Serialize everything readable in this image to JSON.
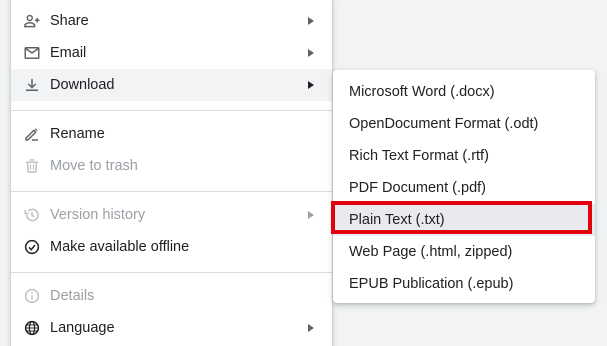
{
  "file_menu": {
    "items": [
      {
        "label": "Share",
        "icon": "person-add-icon",
        "has_submenu": true,
        "disabled": false
      },
      {
        "label": "Email",
        "icon": "mail-icon",
        "has_submenu": true,
        "disabled": false
      },
      {
        "label": "Download",
        "icon": "download-icon",
        "has_submenu": true,
        "disabled": false,
        "highlighted": true
      },
      {
        "label": "Rename",
        "icon": "rename-pencil-icon",
        "has_submenu": false,
        "disabled": false
      },
      {
        "label": "Move to trash",
        "icon": "trash-icon",
        "has_submenu": false,
        "disabled": true
      },
      {
        "label": "Version history",
        "icon": "history-icon",
        "has_submenu": true,
        "disabled": true
      },
      {
        "label": "Make available offline",
        "icon": "offline-check-icon",
        "has_submenu": false,
        "disabled": false
      },
      {
        "label": "Details",
        "icon": "info-icon",
        "has_submenu": false,
        "disabled": true
      },
      {
        "label": "Language",
        "icon": "globe-icon",
        "has_submenu": true,
        "disabled": false
      }
    ]
  },
  "download_submenu": {
    "items": [
      {
        "label": "Microsoft Word (.docx)"
      },
      {
        "label": "OpenDocument Format (.odt)"
      },
      {
        "label": "Rich Text Format (.rtf)"
      },
      {
        "label": "PDF Document (.pdf)"
      },
      {
        "label": "Plain Text (.txt)",
        "hovered": true,
        "annotated": true
      },
      {
        "label": "Web Page (.html, zipped)"
      },
      {
        "label": "EPUB Publication (.epub)"
      }
    ]
  },
  "colors": {
    "text": "#202124",
    "disabled_text": "#9aa0a6",
    "icon": "#5f6368",
    "highlight_bg": "#f1f3f4",
    "hover_bg": "#e8eaed",
    "annotation_red": "#e3000f",
    "separator": "#dadce0"
  }
}
